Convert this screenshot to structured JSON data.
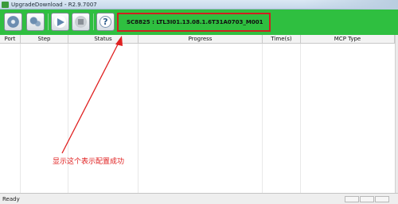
{
  "window": {
    "title": "UpgradeDownload - R2.9.7007"
  },
  "toolbar": {
    "buttons": [
      {
        "icon": "gear-icon"
      },
      {
        "icon": "settings-icon"
      },
      {
        "icon": "play-icon"
      },
      {
        "icon": "stop-icon"
      },
      {
        "icon": "help-icon",
        "glyph": "?"
      }
    ],
    "version": "SC8825 : LTL3I01.13.08.1.6T31A0703_M001",
    "background_color": "#2fbf40",
    "highlight_color": "#d02020"
  },
  "table": {
    "columns": [
      "Port",
      "Step",
      "Status",
      "Progress",
      "Time(s)",
      "MCP Type"
    ]
  },
  "annotation": {
    "text": "显示这个表示配置成功",
    "color": "#e02020"
  },
  "status_bar": {
    "text": "Ready"
  }
}
